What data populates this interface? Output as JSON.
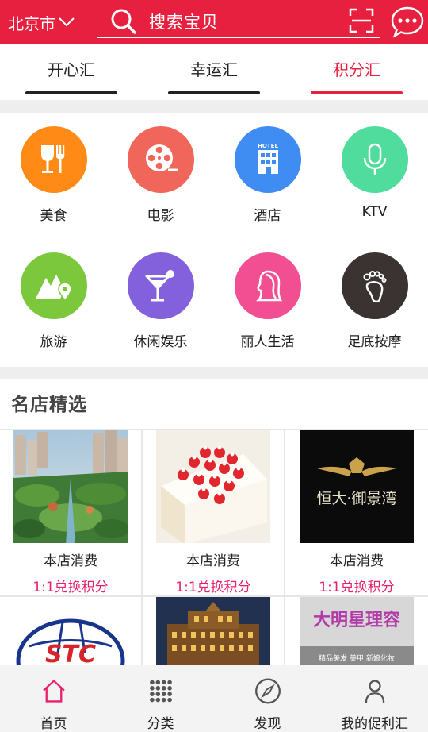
{
  "header": {
    "city": "北京市",
    "search_placeholder": "搜索宝贝"
  },
  "tabs": [
    {
      "label": "开心汇",
      "active": false
    },
    {
      "label": "幸运汇",
      "active": false
    },
    {
      "label": "积分汇",
      "active": true
    }
  ],
  "categories": [
    {
      "label": "美食",
      "icon": "food-icon",
      "color": "#ff8a16"
    },
    {
      "label": "电影",
      "icon": "film-reel-icon",
      "color": "#f0665a"
    },
    {
      "label": "酒店",
      "icon": "hotel-icon",
      "color": "#3f8df2"
    },
    {
      "label": "KTV",
      "icon": "microphone-icon",
      "color": "#4fdc9c"
    },
    {
      "label": "旅游",
      "icon": "mountain-pin-icon",
      "color": "#7cc83c"
    },
    {
      "label": "休闲娱乐",
      "icon": "cocktail-icon",
      "color": "#8360dc"
    },
    {
      "label": "丽人生活",
      "icon": "woman-icon",
      "color": "#f24f92"
    },
    {
      "label": "足底按摩",
      "icon": "foot-icon",
      "color": "#3b3331"
    }
  ],
  "section": {
    "title": "名店精选"
  },
  "stores": [
    {
      "name": "本店消费",
      "rate": "1:1兑换积分",
      "image": "garden-aerial-image"
    },
    {
      "name": "本店消费",
      "rate": "1:1兑换积分",
      "image": "strawberry-cake-image"
    },
    {
      "name": "本店消费",
      "rate": "1:1兑换积分",
      "image": "evergrande-logo-image",
      "logo_text": "恒大·御景湾"
    },
    {
      "name": "",
      "rate": "",
      "image": "globe-logo-image",
      "logo_text": "STC"
    },
    {
      "name": "",
      "rate": "",
      "image": "palace-building-image"
    },
    {
      "name": "",
      "rate": "",
      "image": "beauty-shop-sign-image",
      "logo_text": "大明星理容",
      "sub_text": "精品美发 美甲 新娘化妆"
    }
  ],
  "bottom_nav": [
    {
      "label": "首页",
      "icon": "home-icon",
      "active": true
    },
    {
      "label": "分类",
      "icon": "grid-dots-icon",
      "active": false
    },
    {
      "label": "发现",
      "icon": "compass-icon",
      "active": false
    },
    {
      "label": "我的促利汇",
      "icon": "user-icon",
      "active": false
    }
  ],
  "colors": {
    "brand_red": "#e8203f",
    "points_pink": "#e8206c"
  }
}
